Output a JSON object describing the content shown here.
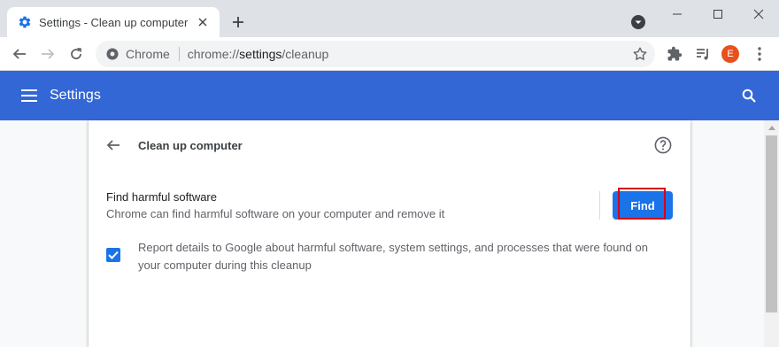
{
  "browser": {
    "tab_title": "Settings - Clean up computer",
    "omnibox_chip": "Chrome",
    "url_prefix": "chrome://",
    "url_path": "settings",
    "url_suffix": "/cleanup",
    "avatar_letter": "E"
  },
  "header": {
    "title": "Settings"
  },
  "page": {
    "title": "Clean up computer",
    "find_section": {
      "title": "Find harmful software",
      "description": "Chrome can find harmful software on your computer and remove it",
      "button_label": "Find"
    },
    "report_checkbox": {
      "checked": true,
      "label": "Report details to Google about harmful software, system settings, and processes that were found on your computer during this cleanup"
    }
  },
  "colors": {
    "header_blue": "#3367d6",
    "button_blue": "#1a73e8",
    "highlight_red": "#d0021b",
    "avatar_orange": "#e8501e"
  }
}
